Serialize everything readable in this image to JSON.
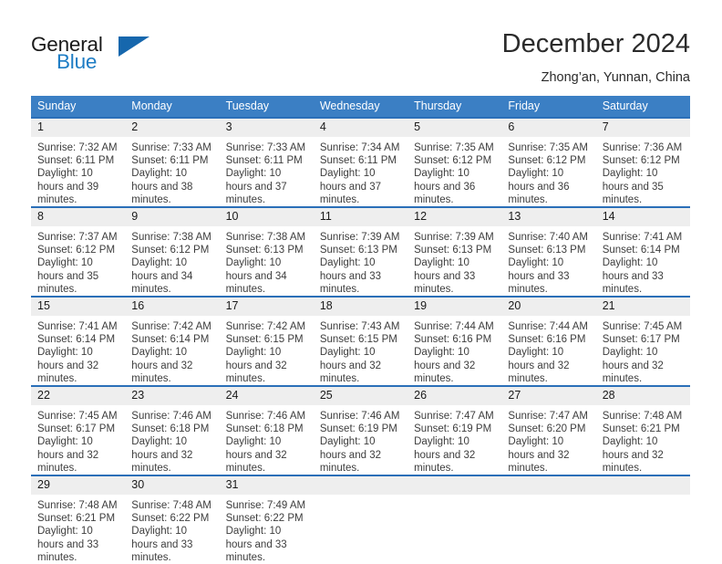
{
  "brand": {
    "name_part1": "General",
    "name_part2": "Blue"
  },
  "header": {
    "title": "December 2024",
    "location": "Zhong’an, Yunnan, China"
  },
  "calendar": {
    "weekday_headers": [
      "Sunday",
      "Monday",
      "Tuesday",
      "Wednesday",
      "Thursday",
      "Friday",
      "Saturday"
    ],
    "accent_color": "#3b7fc4",
    "border_color": "#2a6fb8",
    "daynum_bg": "#eeeeee",
    "weeks": [
      [
        {
          "day": "1",
          "sunrise": "Sunrise: 7:32 AM",
          "sunset": "Sunset: 6:11 PM",
          "daylight": "Daylight: 10 hours and 39 minutes."
        },
        {
          "day": "2",
          "sunrise": "Sunrise: 7:33 AM",
          "sunset": "Sunset: 6:11 PM",
          "daylight": "Daylight: 10 hours and 38 minutes."
        },
        {
          "day": "3",
          "sunrise": "Sunrise: 7:33 AM",
          "sunset": "Sunset: 6:11 PM",
          "daylight": "Daylight: 10 hours and 37 minutes."
        },
        {
          "day": "4",
          "sunrise": "Sunrise: 7:34 AM",
          "sunset": "Sunset: 6:11 PM",
          "daylight": "Daylight: 10 hours and 37 minutes."
        },
        {
          "day": "5",
          "sunrise": "Sunrise: 7:35 AM",
          "sunset": "Sunset: 6:12 PM",
          "daylight": "Daylight: 10 hours and 36 minutes."
        },
        {
          "day": "6",
          "sunrise": "Sunrise: 7:35 AM",
          "sunset": "Sunset: 6:12 PM",
          "daylight": "Daylight: 10 hours and 36 minutes."
        },
        {
          "day": "7",
          "sunrise": "Sunrise: 7:36 AM",
          "sunset": "Sunset: 6:12 PM",
          "daylight": "Daylight: 10 hours and 35 minutes."
        }
      ],
      [
        {
          "day": "8",
          "sunrise": "Sunrise: 7:37 AM",
          "sunset": "Sunset: 6:12 PM",
          "daylight": "Daylight: 10 hours and 35 minutes."
        },
        {
          "day": "9",
          "sunrise": "Sunrise: 7:38 AM",
          "sunset": "Sunset: 6:12 PM",
          "daylight": "Daylight: 10 hours and 34 minutes."
        },
        {
          "day": "10",
          "sunrise": "Sunrise: 7:38 AM",
          "sunset": "Sunset: 6:13 PM",
          "daylight": "Daylight: 10 hours and 34 minutes."
        },
        {
          "day": "11",
          "sunrise": "Sunrise: 7:39 AM",
          "sunset": "Sunset: 6:13 PM",
          "daylight": "Daylight: 10 hours and 33 minutes."
        },
        {
          "day": "12",
          "sunrise": "Sunrise: 7:39 AM",
          "sunset": "Sunset: 6:13 PM",
          "daylight": "Daylight: 10 hours and 33 minutes."
        },
        {
          "day": "13",
          "sunrise": "Sunrise: 7:40 AM",
          "sunset": "Sunset: 6:13 PM",
          "daylight": "Daylight: 10 hours and 33 minutes."
        },
        {
          "day": "14",
          "sunrise": "Sunrise: 7:41 AM",
          "sunset": "Sunset: 6:14 PM",
          "daylight": "Daylight: 10 hours and 33 minutes."
        }
      ],
      [
        {
          "day": "15",
          "sunrise": "Sunrise: 7:41 AM",
          "sunset": "Sunset: 6:14 PM",
          "daylight": "Daylight: 10 hours and 32 minutes."
        },
        {
          "day": "16",
          "sunrise": "Sunrise: 7:42 AM",
          "sunset": "Sunset: 6:14 PM",
          "daylight": "Daylight: 10 hours and 32 minutes."
        },
        {
          "day": "17",
          "sunrise": "Sunrise: 7:42 AM",
          "sunset": "Sunset: 6:15 PM",
          "daylight": "Daylight: 10 hours and 32 minutes."
        },
        {
          "day": "18",
          "sunrise": "Sunrise: 7:43 AM",
          "sunset": "Sunset: 6:15 PM",
          "daylight": "Daylight: 10 hours and 32 minutes."
        },
        {
          "day": "19",
          "sunrise": "Sunrise: 7:44 AM",
          "sunset": "Sunset: 6:16 PM",
          "daylight": "Daylight: 10 hours and 32 minutes."
        },
        {
          "day": "20",
          "sunrise": "Sunrise: 7:44 AM",
          "sunset": "Sunset: 6:16 PM",
          "daylight": "Daylight: 10 hours and 32 minutes."
        },
        {
          "day": "21",
          "sunrise": "Sunrise: 7:45 AM",
          "sunset": "Sunset: 6:17 PM",
          "daylight": "Daylight: 10 hours and 32 minutes."
        }
      ],
      [
        {
          "day": "22",
          "sunrise": "Sunrise: 7:45 AM",
          "sunset": "Sunset: 6:17 PM",
          "daylight": "Daylight: 10 hours and 32 minutes."
        },
        {
          "day": "23",
          "sunrise": "Sunrise: 7:46 AM",
          "sunset": "Sunset: 6:18 PM",
          "daylight": "Daylight: 10 hours and 32 minutes."
        },
        {
          "day": "24",
          "sunrise": "Sunrise: 7:46 AM",
          "sunset": "Sunset: 6:18 PM",
          "daylight": "Daylight: 10 hours and 32 minutes."
        },
        {
          "day": "25",
          "sunrise": "Sunrise: 7:46 AM",
          "sunset": "Sunset: 6:19 PM",
          "daylight": "Daylight: 10 hours and 32 minutes."
        },
        {
          "day": "26",
          "sunrise": "Sunrise: 7:47 AM",
          "sunset": "Sunset: 6:19 PM",
          "daylight": "Daylight: 10 hours and 32 minutes."
        },
        {
          "day": "27",
          "sunrise": "Sunrise: 7:47 AM",
          "sunset": "Sunset: 6:20 PM",
          "daylight": "Daylight: 10 hours and 32 minutes."
        },
        {
          "day": "28",
          "sunrise": "Sunrise: 7:48 AM",
          "sunset": "Sunset: 6:21 PM",
          "daylight": "Daylight: 10 hours and 32 minutes."
        }
      ],
      [
        {
          "day": "29",
          "sunrise": "Sunrise: 7:48 AM",
          "sunset": "Sunset: 6:21 PM",
          "daylight": "Daylight: 10 hours and 33 minutes."
        },
        {
          "day": "30",
          "sunrise": "Sunrise: 7:48 AM",
          "sunset": "Sunset: 6:22 PM",
          "daylight": "Daylight: 10 hours and 33 minutes."
        },
        {
          "day": "31",
          "sunrise": "Sunrise: 7:49 AM",
          "sunset": "Sunset: 6:22 PM",
          "daylight": "Daylight: 10 hours and 33 minutes."
        },
        {
          "day": "",
          "sunrise": "",
          "sunset": "",
          "daylight": ""
        },
        {
          "day": "",
          "sunrise": "",
          "sunset": "",
          "daylight": ""
        },
        {
          "day": "",
          "sunrise": "",
          "sunset": "",
          "daylight": ""
        },
        {
          "day": "",
          "sunrise": "",
          "sunset": "",
          "daylight": ""
        }
      ]
    ]
  }
}
